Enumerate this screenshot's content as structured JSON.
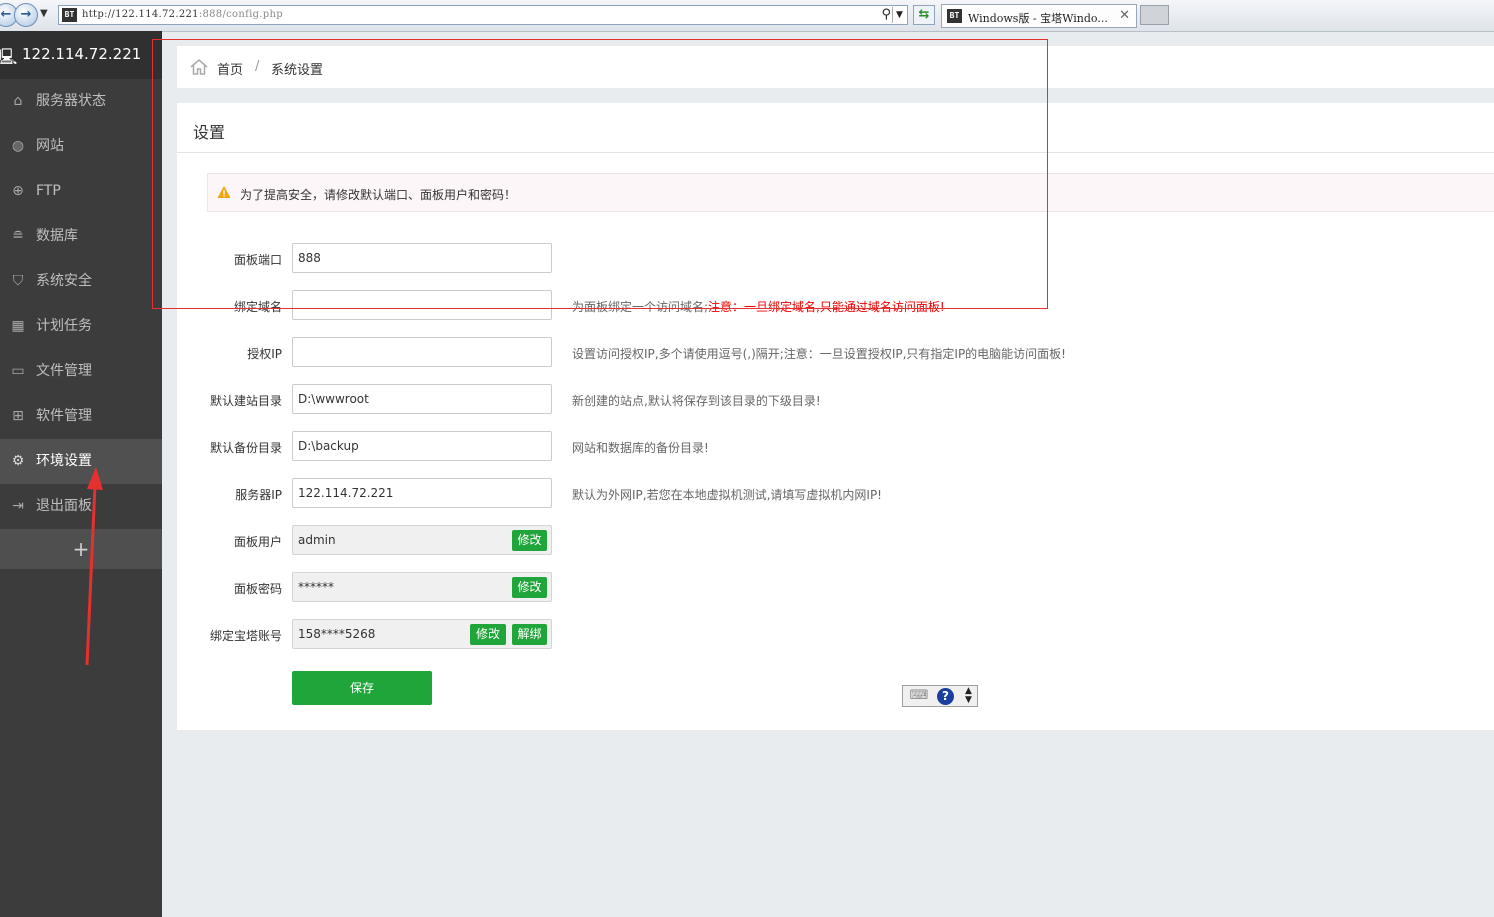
{
  "browser": {
    "url_host": "http://122.114.72.221",
    "url_rest": ":888/config.php",
    "favicon_text": "BT",
    "tab_title": "Windows版 - 宝塔Windo...",
    "tab_close": "✕",
    "back_icon": "back-arrow-icon",
    "forward_icon": "forward-arrow-icon"
  },
  "sidebar": {
    "host": "122.114.72.221",
    "items": [
      {
        "label": "服务器状态",
        "icon": "home-icon"
      },
      {
        "label": "网站",
        "icon": "globe-icon"
      },
      {
        "label": "FTP",
        "icon": "ftp-icon"
      },
      {
        "label": "数据库",
        "icon": "database-icon"
      },
      {
        "label": "系统安全",
        "icon": "shield-icon"
      },
      {
        "label": "计划任务",
        "icon": "calendar-icon"
      },
      {
        "label": "文件管理",
        "icon": "folder-icon"
      },
      {
        "label": "软件管理",
        "icon": "apps-icon"
      },
      {
        "label": "环境设置",
        "icon": "gear-icon",
        "active": true
      },
      {
        "label": "退出面板",
        "icon": "logout-icon"
      }
    ],
    "add_label": "+"
  },
  "breadcrumb": {
    "home": "首页",
    "separator": "/",
    "current": "系统设置"
  },
  "panel": {
    "title": "设置",
    "alert": "为了提高安全，请修改默认端口、面板用户和密码！",
    "fields": [
      {
        "label": "面板端口",
        "value": "888",
        "hint": "",
        "hint_warn": ""
      },
      {
        "label": "绑定域名",
        "value": "",
        "hint": "为面板绑定一个访问域名;",
        "hint_warn": "注意：一旦绑定域名,只能通过域名访问面板!"
      },
      {
        "label": "授权IP",
        "value": "",
        "hint": "设置访问授权IP,多个请使用逗号(,)隔开;注意：一旦设置授权IP,只有指定IP的电脑能访问面板!",
        "hint_warn": ""
      },
      {
        "label": "默认建站目录",
        "value": "D:\\wwwroot",
        "hint": "新创建的站点,默认将保存到该目录的下级目录!",
        "hint_warn": ""
      },
      {
        "label": "默认备份目录",
        "value": "D:\\backup",
        "hint": "网站和数据库的备份目录!",
        "hint_warn": ""
      },
      {
        "label": "服务器IP",
        "value": "122.114.72.221",
        "hint": "默认为外网IP,若您在本地虚拟机测试,请填写虚拟机内网IP!",
        "hint_warn": ""
      },
      {
        "label": "面板用户",
        "value": "admin",
        "button": "修改"
      },
      {
        "label": "面板密码",
        "value": "******",
        "button": "修改"
      },
      {
        "label": "绑定宝塔账号",
        "value": "158****5268",
        "button": "修改",
        "button2": "解绑"
      }
    ],
    "save_label": "保存"
  },
  "colors": {
    "primary_green": "#20a53a",
    "sidebar_bg": "#3c3c3c",
    "warning_red": "#e00000",
    "annotation_red": "#e53030"
  }
}
